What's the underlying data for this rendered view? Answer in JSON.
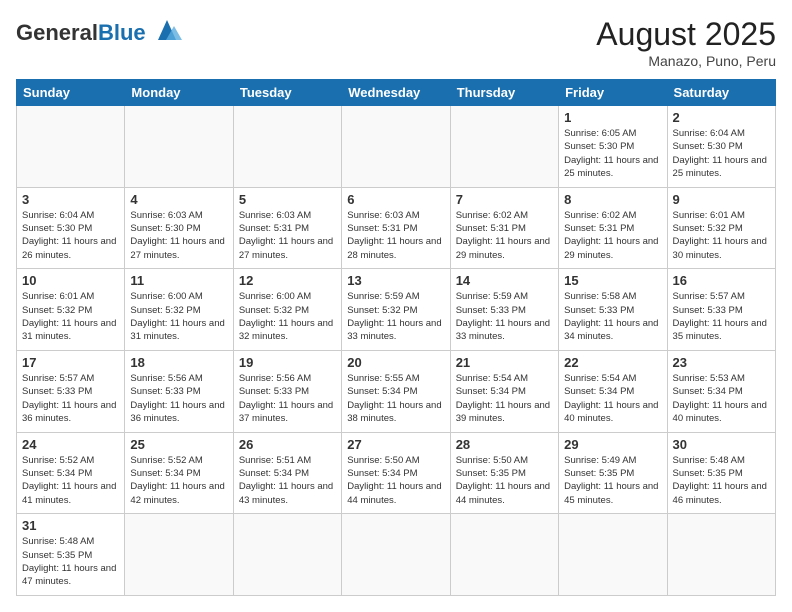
{
  "header": {
    "logo_general": "General",
    "logo_blue": "Blue",
    "month_year": "August 2025",
    "location": "Manazo, Puno, Peru"
  },
  "weekdays": [
    "Sunday",
    "Monday",
    "Tuesday",
    "Wednesday",
    "Thursday",
    "Friday",
    "Saturday"
  ],
  "weeks": [
    [
      {
        "day": "",
        "info": ""
      },
      {
        "day": "",
        "info": ""
      },
      {
        "day": "",
        "info": ""
      },
      {
        "day": "",
        "info": ""
      },
      {
        "day": "",
        "info": ""
      },
      {
        "day": "1",
        "info": "Sunrise: 6:05 AM\nSunset: 5:30 PM\nDaylight: 11 hours and 25 minutes."
      },
      {
        "day": "2",
        "info": "Sunrise: 6:04 AM\nSunset: 5:30 PM\nDaylight: 11 hours and 25 minutes."
      }
    ],
    [
      {
        "day": "3",
        "info": "Sunrise: 6:04 AM\nSunset: 5:30 PM\nDaylight: 11 hours and 26 minutes."
      },
      {
        "day": "4",
        "info": "Sunrise: 6:03 AM\nSunset: 5:30 PM\nDaylight: 11 hours and 27 minutes."
      },
      {
        "day": "5",
        "info": "Sunrise: 6:03 AM\nSunset: 5:31 PM\nDaylight: 11 hours and 27 minutes."
      },
      {
        "day": "6",
        "info": "Sunrise: 6:03 AM\nSunset: 5:31 PM\nDaylight: 11 hours and 28 minutes."
      },
      {
        "day": "7",
        "info": "Sunrise: 6:02 AM\nSunset: 5:31 PM\nDaylight: 11 hours and 29 minutes."
      },
      {
        "day": "8",
        "info": "Sunrise: 6:02 AM\nSunset: 5:31 PM\nDaylight: 11 hours and 29 minutes."
      },
      {
        "day": "9",
        "info": "Sunrise: 6:01 AM\nSunset: 5:32 PM\nDaylight: 11 hours and 30 minutes."
      }
    ],
    [
      {
        "day": "10",
        "info": "Sunrise: 6:01 AM\nSunset: 5:32 PM\nDaylight: 11 hours and 31 minutes."
      },
      {
        "day": "11",
        "info": "Sunrise: 6:00 AM\nSunset: 5:32 PM\nDaylight: 11 hours and 31 minutes."
      },
      {
        "day": "12",
        "info": "Sunrise: 6:00 AM\nSunset: 5:32 PM\nDaylight: 11 hours and 32 minutes."
      },
      {
        "day": "13",
        "info": "Sunrise: 5:59 AM\nSunset: 5:32 PM\nDaylight: 11 hours and 33 minutes."
      },
      {
        "day": "14",
        "info": "Sunrise: 5:59 AM\nSunset: 5:33 PM\nDaylight: 11 hours and 33 minutes."
      },
      {
        "day": "15",
        "info": "Sunrise: 5:58 AM\nSunset: 5:33 PM\nDaylight: 11 hours and 34 minutes."
      },
      {
        "day": "16",
        "info": "Sunrise: 5:57 AM\nSunset: 5:33 PM\nDaylight: 11 hours and 35 minutes."
      }
    ],
    [
      {
        "day": "17",
        "info": "Sunrise: 5:57 AM\nSunset: 5:33 PM\nDaylight: 11 hours and 36 minutes."
      },
      {
        "day": "18",
        "info": "Sunrise: 5:56 AM\nSunset: 5:33 PM\nDaylight: 11 hours and 36 minutes."
      },
      {
        "day": "19",
        "info": "Sunrise: 5:56 AM\nSunset: 5:33 PM\nDaylight: 11 hours and 37 minutes."
      },
      {
        "day": "20",
        "info": "Sunrise: 5:55 AM\nSunset: 5:34 PM\nDaylight: 11 hours and 38 minutes."
      },
      {
        "day": "21",
        "info": "Sunrise: 5:54 AM\nSunset: 5:34 PM\nDaylight: 11 hours and 39 minutes."
      },
      {
        "day": "22",
        "info": "Sunrise: 5:54 AM\nSunset: 5:34 PM\nDaylight: 11 hours and 40 minutes."
      },
      {
        "day": "23",
        "info": "Sunrise: 5:53 AM\nSunset: 5:34 PM\nDaylight: 11 hours and 40 minutes."
      }
    ],
    [
      {
        "day": "24",
        "info": "Sunrise: 5:52 AM\nSunset: 5:34 PM\nDaylight: 11 hours and 41 minutes."
      },
      {
        "day": "25",
        "info": "Sunrise: 5:52 AM\nSunset: 5:34 PM\nDaylight: 11 hours and 42 minutes."
      },
      {
        "day": "26",
        "info": "Sunrise: 5:51 AM\nSunset: 5:34 PM\nDaylight: 11 hours and 43 minutes."
      },
      {
        "day": "27",
        "info": "Sunrise: 5:50 AM\nSunset: 5:34 PM\nDaylight: 11 hours and 44 minutes."
      },
      {
        "day": "28",
        "info": "Sunrise: 5:50 AM\nSunset: 5:35 PM\nDaylight: 11 hours and 44 minutes."
      },
      {
        "day": "29",
        "info": "Sunrise: 5:49 AM\nSunset: 5:35 PM\nDaylight: 11 hours and 45 minutes."
      },
      {
        "day": "30",
        "info": "Sunrise: 5:48 AM\nSunset: 5:35 PM\nDaylight: 11 hours and 46 minutes."
      }
    ],
    [
      {
        "day": "31",
        "info": "Sunrise: 5:48 AM\nSunset: 5:35 PM\nDaylight: 11 hours and 47 minutes."
      },
      {
        "day": "",
        "info": ""
      },
      {
        "day": "",
        "info": ""
      },
      {
        "day": "",
        "info": ""
      },
      {
        "day": "",
        "info": ""
      },
      {
        "day": "",
        "info": ""
      },
      {
        "day": "",
        "info": ""
      }
    ]
  ]
}
